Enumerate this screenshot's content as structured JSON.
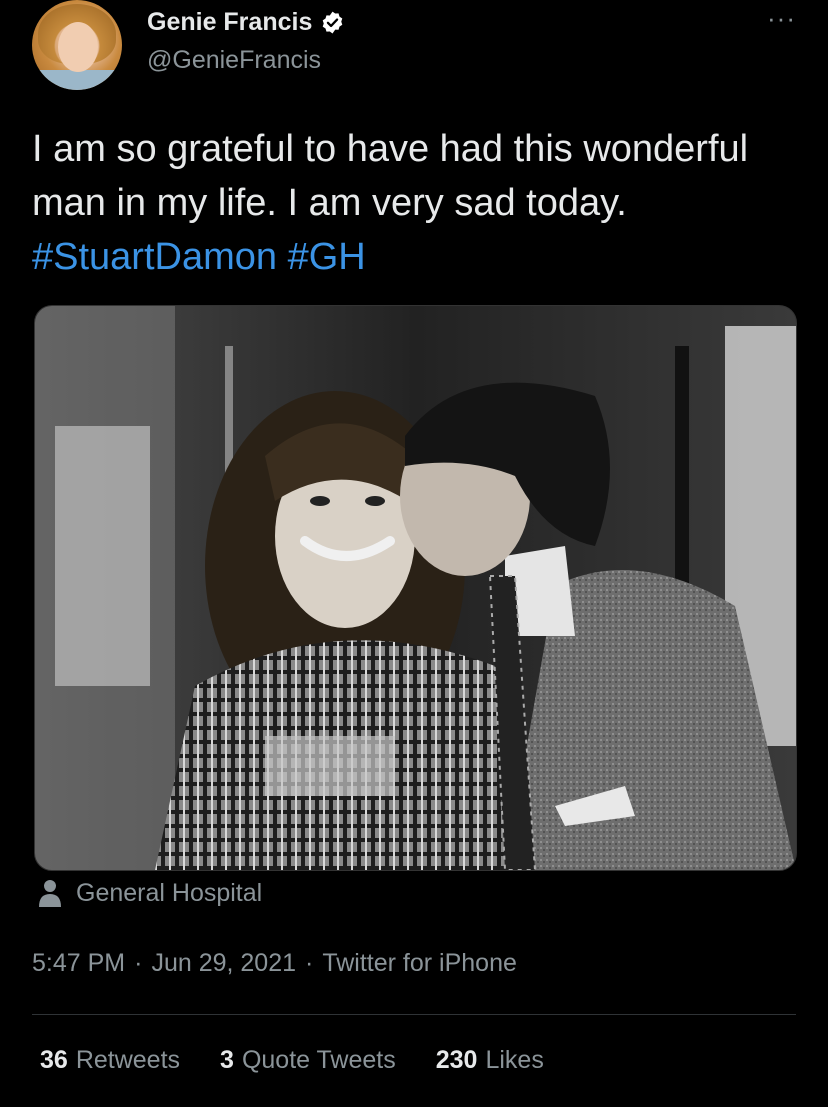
{
  "author": {
    "display_name": "Genie Francis",
    "handle": "@GenieFrancis",
    "verified": true
  },
  "tweet": {
    "text_parts": [
      {
        "text": "I am so grateful to have had this wonderful man in my life. I am very sad today. ",
        "type": "text"
      },
      {
        "text": "#StuartDamon",
        "type": "hashtag"
      },
      {
        "text": " ",
        "type": "text"
      },
      {
        "text": "#GH",
        "type": "hashtag"
      }
    ],
    "location": "General Hospital",
    "time": "5:47 PM",
    "date": "Jun 29, 2021",
    "source": "Twitter for iPhone",
    "separator": "·"
  },
  "stats": {
    "retweets": {
      "count": "36",
      "label": "Retweets"
    },
    "quote_tweets": {
      "count": "3",
      "label": "Quote Tweets"
    },
    "likes": {
      "count": "230",
      "label": "Likes"
    }
  },
  "icons": {
    "more": "more-options-icon",
    "verified": "verified-badge-icon",
    "location": "person-location-icon"
  },
  "colors": {
    "background": "#000000",
    "primary_text": "#e7e9ea",
    "secondary_text": "#8b9499",
    "hashtag": "#3b93e5",
    "verified_badge": "#ffffff"
  },
  "more_glyph": "···"
}
